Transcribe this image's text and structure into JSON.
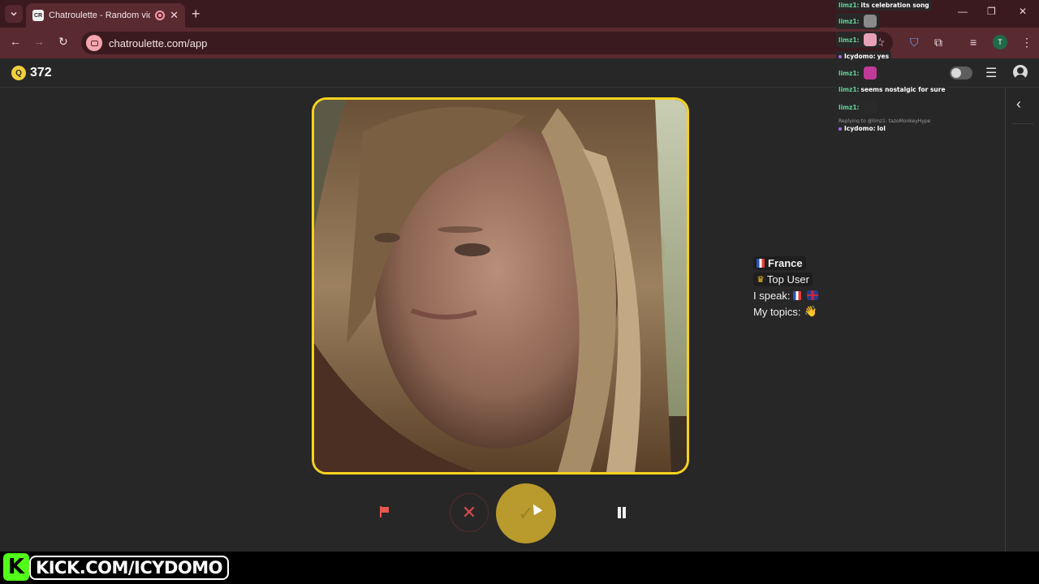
{
  "browser": {
    "tab_favicon": "CR",
    "tab_title": "Chatroulette - Random vide",
    "url": "chatroulette.com/app",
    "profile_initial": "T"
  },
  "app": {
    "coin_symbol": "Q",
    "coin_count": "372"
  },
  "partner": {
    "country": "France",
    "badge": "Top User",
    "speak_label": "I speak:",
    "topics_label": "My topics:",
    "topic_emoji": "👋"
  },
  "icons": {
    "report": "flag-icon",
    "skip": "close-icon",
    "accept": "check-icon",
    "pause": "pause-icon",
    "panel": "chevron-left-icon"
  },
  "colors": {
    "accent_yellow": "#f5d31b",
    "browser_chrome": "#5a2a31",
    "app_background": "#272727",
    "kick_green": "#53fc18"
  },
  "chat": {
    "messages": [
      {
        "user": "limz1:",
        "text": "its celebration song"
      },
      {
        "user": "limz1:",
        "text": ""
      },
      {
        "user": "limz1:",
        "text": ""
      },
      {
        "user": "Icydomo:",
        "text": "yes"
      },
      {
        "user": "limz1:",
        "text": ""
      },
      {
        "user": "limz1:",
        "text": "seems nostalgic for sure"
      },
      {
        "user": "limz1:",
        "text": ""
      },
      {
        "user": "Icydomo:",
        "text": "lol"
      }
    ],
    "reply_note": "Replying to @limz1: tazoMonkeyHype"
  },
  "overlay": {
    "kick_letter": "K",
    "kick_url": "KICK.COM/ICYDOMO"
  }
}
